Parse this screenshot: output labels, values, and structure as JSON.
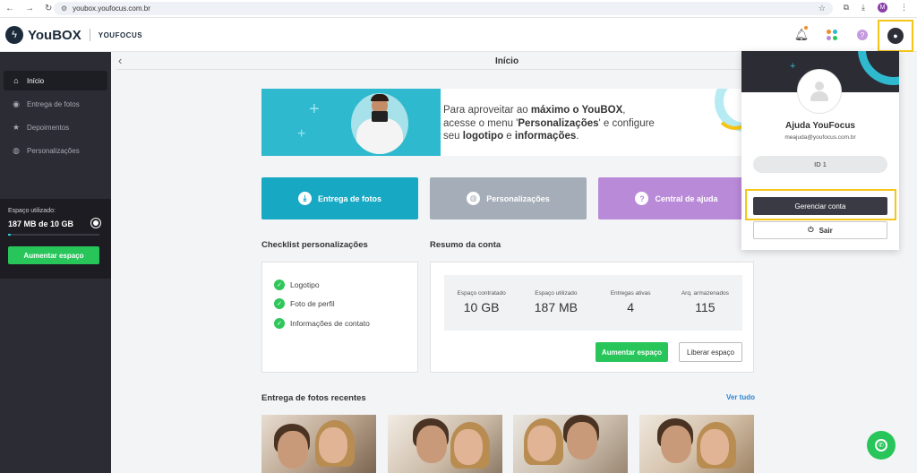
{
  "browser": {
    "url": "youbox.youfocus.com.br",
    "profile_initial": "M"
  },
  "header": {
    "brand": "YouBOX",
    "sub_brand": "YOUFOCUS"
  },
  "sidebar": {
    "items": [
      {
        "label": "Início",
        "icon": "home-icon",
        "active": true
      },
      {
        "label": "Entrega de fotos",
        "icon": "photo-delivery-icon",
        "active": false
      },
      {
        "label": "Depoimentos",
        "icon": "star-icon",
        "active": false
      },
      {
        "label": "Personalizações",
        "icon": "palette-icon",
        "active": false
      }
    ],
    "storage": {
      "label": "Espaço utilizado:",
      "value": "187 MB de 10 GB",
      "used_fraction": 0.018,
      "button": "Aumentar espaço"
    }
  },
  "main": {
    "page_title": "Início",
    "banner": {
      "line1_pre": "Para aproveitar ao ",
      "line1_bold": "máximo o YouBOX",
      "line1_post": ",",
      "line2_pre": "acesse o menu '",
      "line2_bold": "Personalizações",
      "line2_post": "' e configure",
      "line3_pre": "seu ",
      "line3_bold1": "logotipo",
      "line3_mid": " e ",
      "line3_bold2": "informações",
      "line3_post": "."
    },
    "quick_buttons": [
      {
        "label": "Entrega de fotos",
        "icon": "download-icon",
        "color": "#17a8c4"
      },
      {
        "label": "Personalizações",
        "icon": "palette-icon",
        "color": "#a5adb8"
      },
      {
        "label": "Central de ajuda",
        "icon": "help-icon",
        "color": "#b98ad8"
      }
    ],
    "checklist": {
      "title": "Checklist personalizações",
      "items": [
        "Logotipo",
        "Foto de perfil",
        "Informações de contato"
      ]
    },
    "resumo": {
      "title": "Resumo da conta",
      "stats": [
        {
          "label": "Espaço contratado",
          "value": "10 GB"
        },
        {
          "label": "Espaço utilizado",
          "value": "187 MB"
        },
        {
          "label": "Entregas ativas",
          "value": "4"
        },
        {
          "label": "Arq. armazenados",
          "value": "115"
        }
      ],
      "increase_button": "Aumentar espaço",
      "free_button": "Liberar espaço"
    },
    "recent": {
      "title": "Entrega de fotos recentes",
      "see_all": "Ver tudo"
    }
  },
  "account_panel": {
    "name": "Ajuda YouFocus",
    "email": "meajuda@youfocus.com.br",
    "id_label": "ID 1",
    "manage_button": "Gerenciar conta",
    "logout_button": "Sair"
  },
  "colors": {
    "accent_cyan": "#17a8c4",
    "green": "#27c55a",
    "sidebar": "#2c2c35",
    "highlight": "#f5c518"
  }
}
